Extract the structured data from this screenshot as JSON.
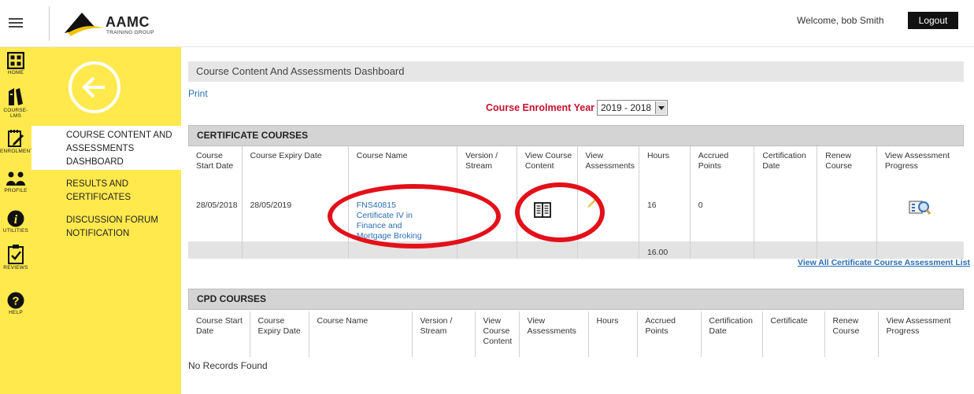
{
  "header": {
    "logo_text": "AAMC",
    "logo_subtext": "TRAINING GROUP",
    "welcome": "Welcome, bob Smith",
    "logout_label": "Logout"
  },
  "rail": {
    "items": [
      {
        "label": "HOME",
        "icon": "grid-icon"
      },
      {
        "label": "COURSE-LMS",
        "icon": "books-icon"
      },
      {
        "label": "ENROLMENTS",
        "icon": "notepad-pencil-icon"
      },
      {
        "label": "PROFILE",
        "icon": "people-icon"
      },
      {
        "label": "UTILITIES",
        "icon": "info-icon"
      },
      {
        "label": "REVIEWS",
        "icon": "clipboard-check-icon"
      },
      {
        "label": "HELP",
        "icon": "question-icon"
      }
    ]
  },
  "nav": {
    "back_icon": "arrow-left-circle-icon",
    "links": [
      "COURSE CONTENT AND ASSESSMENTS DASHBOARD",
      "RESULTS AND CERTIFICATES",
      "DISCUSSION FORUM",
      "NOTIFICATION"
    ]
  },
  "main": {
    "title": "Course Content And Assessments Dashboard",
    "print_label": "Print",
    "year_label": "Course Enrolment Year",
    "year_value": "2019 - 2018",
    "certificate": {
      "section_title": "CERTIFICATE COURSES",
      "columns": [
        "Course Start Date",
        "Course Expiry Date",
        "Course Name",
        "Version / Stream",
        "View Course Content",
        "View Assessments",
        "Hours",
        "Accrued Points",
        "Certification Date",
        "Renew Course",
        "View Assessment Progress"
      ],
      "rows": [
        {
          "start": "28/05/2018",
          "expiry": "28/05/2019",
          "name": "FNS40815 Certificate IV in Finance and Mortgage Broking",
          "version": "",
          "hours": "16",
          "points": "0",
          "cert_date": "",
          "renew": ""
        }
      ],
      "total_hours": "16.00",
      "view_all_label": "View All Certificate Course Assessment List"
    },
    "cpd": {
      "section_title": "CPD COURSES",
      "columns": [
        "Course Start Date",
        "Course Expiry Date",
        "Course Name",
        "Version / Stream",
        "View Course Content",
        "View Assessments",
        "Hours",
        "Accrued Points",
        "Certification Date",
        "Certificate",
        "Renew Course",
        "View Assessment Progress"
      ],
      "empty_label": "No Records Found"
    }
  },
  "colors": {
    "accent_yellow": "#ffe94d",
    "highlight_red": "#e3101a",
    "link_blue": "#2a6eb5",
    "label_red": "#c8102e"
  }
}
